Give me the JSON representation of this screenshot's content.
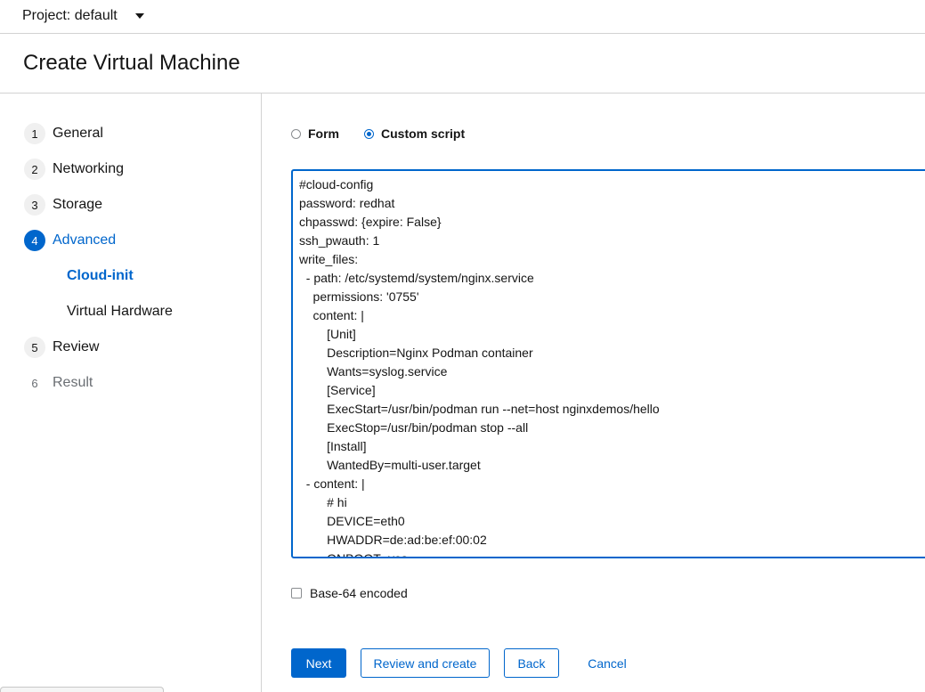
{
  "project": {
    "label": "Project: default"
  },
  "page": {
    "title": "Create Virtual Machine"
  },
  "wizard": {
    "steps": [
      {
        "number": "1",
        "label": "General"
      },
      {
        "number": "2",
        "label": "Networking"
      },
      {
        "number": "3",
        "label": "Storage"
      },
      {
        "number": "4",
        "label": "Advanced"
      },
      {
        "number": "5",
        "label": "Review"
      },
      {
        "number": "6",
        "label": "Result"
      }
    ],
    "substeps": [
      {
        "label": "Cloud-init"
      },
      {
        "label": "Virtual Hardware"
      }
    ]
  },
  "mode": {
    "form_label": "Form",
    "script_label": "Custom script",
    "selected": "Custom script"
  },
  "script": {
    "lines": [
      "#cloud-config",
      "password: redhat",
      "chpasswd: {expire: False}",
      "ssh_pwauth: 1",
      "write_files:",
      "  - path: /etc/systemd/system/nginx.service",
      "    permissions: '0755'",
      "    content: |",
      "        [Unit]",
      "        Description=Nginx Podman container",
      "        Wants=syslog.service",
      "        [Service]",
      "        ExecStart=/usr/bin/podman run --net=host nginxdemos/hello",
      "        ExecStop=/usr/bin/podman stop --all",
      "        [Install]",
      "        WantedBy=multi-user.target",
      "  - content: |",
      "        # hi",
      "        DEVICE=eth0",
      "        HWADDR=de:ad:be:ef:00:02",
      "        ONBOOT=yes"
    ]
  },
  "base64": {
    "label": "Base-64 encoded",
    "checked": false
  },
  "actions": {
    "next": "Next",
    "review_create": "Review and create",
    "back": "Back",
    "cancel": "Cancel"
  },
  "colors": {
    "accent": "#0066cc",
    "border": "#d2d2d2",
    "text": "#151515",
    "disabled": "#6a6e73"
  }
}
